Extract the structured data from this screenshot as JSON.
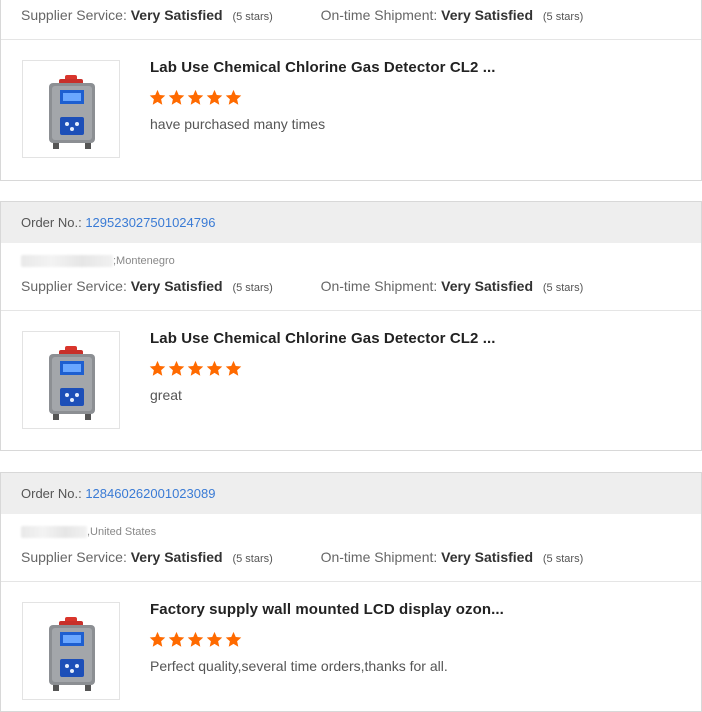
{
  "colors": {
    "accent_link": "#3a7bd5",
    "star": "#ff6a00",
    "header_bg": "#eeeeee"
  },
  "top": {
    "supplier_label": "Supplier Service:",
    "supplier_value": "Very Satisfied",
    "supplier_stars": "(5 stars)",
    "shipment_label": "On-time Shipment:",
    "shipment_value": "Very Satisfied",
    "shipment_stars": "(5 stars)",
    "product_title": "Lab Use Chemical Chlorine Gas Detector CL2 ...",
    "rating": 5,
    "comment": "have purchased many times"
  },
  "orders": [
    {
      "order_label": "Order No.:",
      "order_number": "129523027501024796",
      "buyer_location": ";Montenegro",
      "supplier_label": "Supplier Service:",
      "supplier_value": "Very Satisfied",
      "supplier_stars": "(5 stars)",
      "shipment_label": "On-time Shipment:",
      "shipment_value": "Very Satisfied",
      "shipment_stars": "(5 stars)",
      "product_title": "Lab Use Chemical Chlorine Gas Detector CL2 ...",
      "rating": 5,
      "comment": "great"
    },
    {
      "order_label": "Order No.:",
      "order_number": "128460262001023089",
      "buyer_location": ",United States",
      "supplier_label": "Supplier Service:",
      "supplier_value": "Very Satisfied",
      "supplier_stars": "(5 stars)",
      "shipment_label": "On-time Shipment:",
      "shipment_value": "Very Satisfied",
      "shipment_stars": "(5 stars)",
      "product_title": "Factory supply wall mounted LCD display ozon...",
      "rating": 5,
      "comment": "Perfect quality,several time orders,thanks for all."
    }
  ]
}
